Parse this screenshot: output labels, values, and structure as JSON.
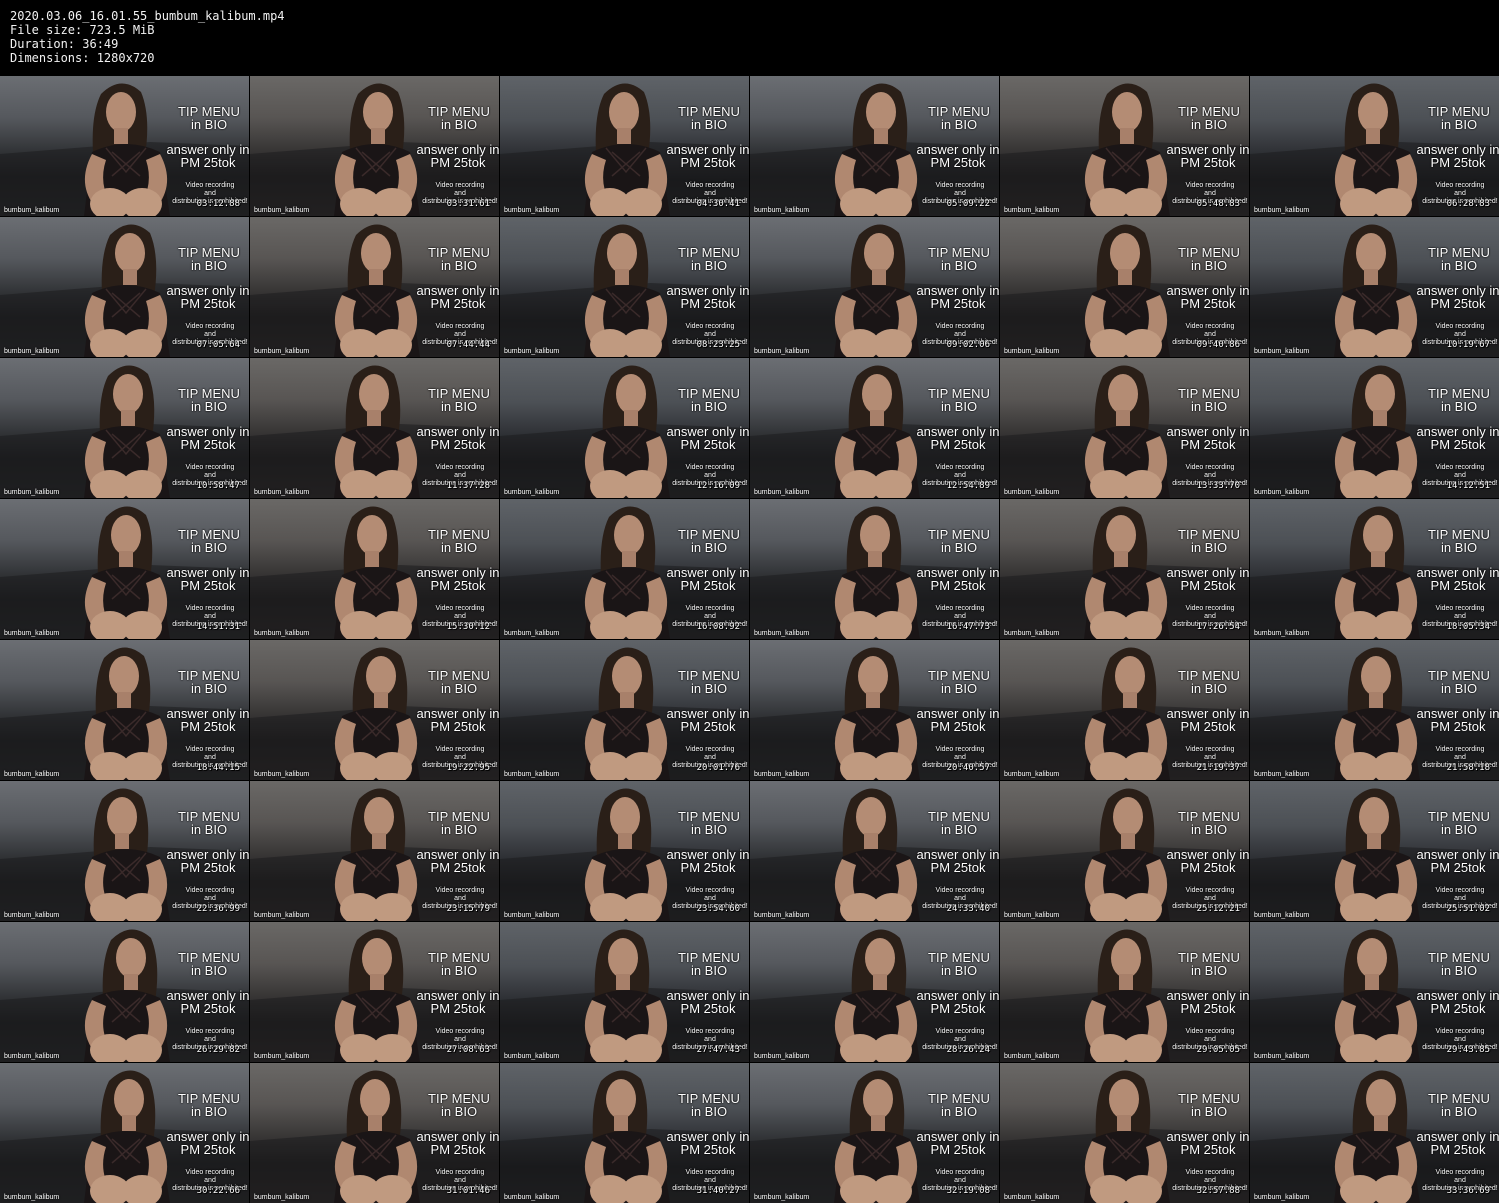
{
  "header": {
    "filename": "2020.03.06_16.01.55_bumbum_kalibum.mp4",
    "file_size": "File size: 723.5 MiB",
    "duration": "Duration: 36:49",
    "dimensions": "Dimensions: 1280x720"
  },
  "overlay": {
    "tip_line1": "TIP MENU",
    "tip_line2": "in BIO",
    "answer_line1": "answer only in",
    "answer_line2": "PM 25tok",
    "notice_line1": "Video recording",
    "notice_line2": "and",
    "notice_line3": "distribution is prohibited!",
    "watermark": "bumbum_kalibum"
  },
  "timestamps": [
    "03:12.88",
    "03:31.61",
    "04:30.41",
    "05:09.22",
    "05:48.83",
    "06:28.83",
    "07:05.64",
    "07:44.44",
    "08:23.25",
    "09:02.06",
    "09:40.86",
    "10:19.67",
    "10:58.47",
    "11:37.28",
    "12:16.09",
    "12:54.89",
    "13:33.70",
    "14:12.51",
    "14:51.31",
    "15:30.12",
    "16:08.92",
    "16:47.73",
    "17:26.54",
    "18:05.34",
    "18:44.15",
    "19:22.95",
    "20:01.76",
    "20:40.57",
    "21:19.37",
    "21:58.18",
    "22:36.99",
    "23:15.79",
    "23:54.60",
    "24:33.40",
    "25:12.21",
    "25:51.02",
    "26:29.82",
    "27:08.63",
    "27:47.43",
    "28:26.24",
    "29:05.05",
    "29:43.85",
    "30:22.66",
    "31:01.46",
    "31:40.27",
    "32:19.08",
    "32:57.88",
    "33:36.69"
  ]
}
